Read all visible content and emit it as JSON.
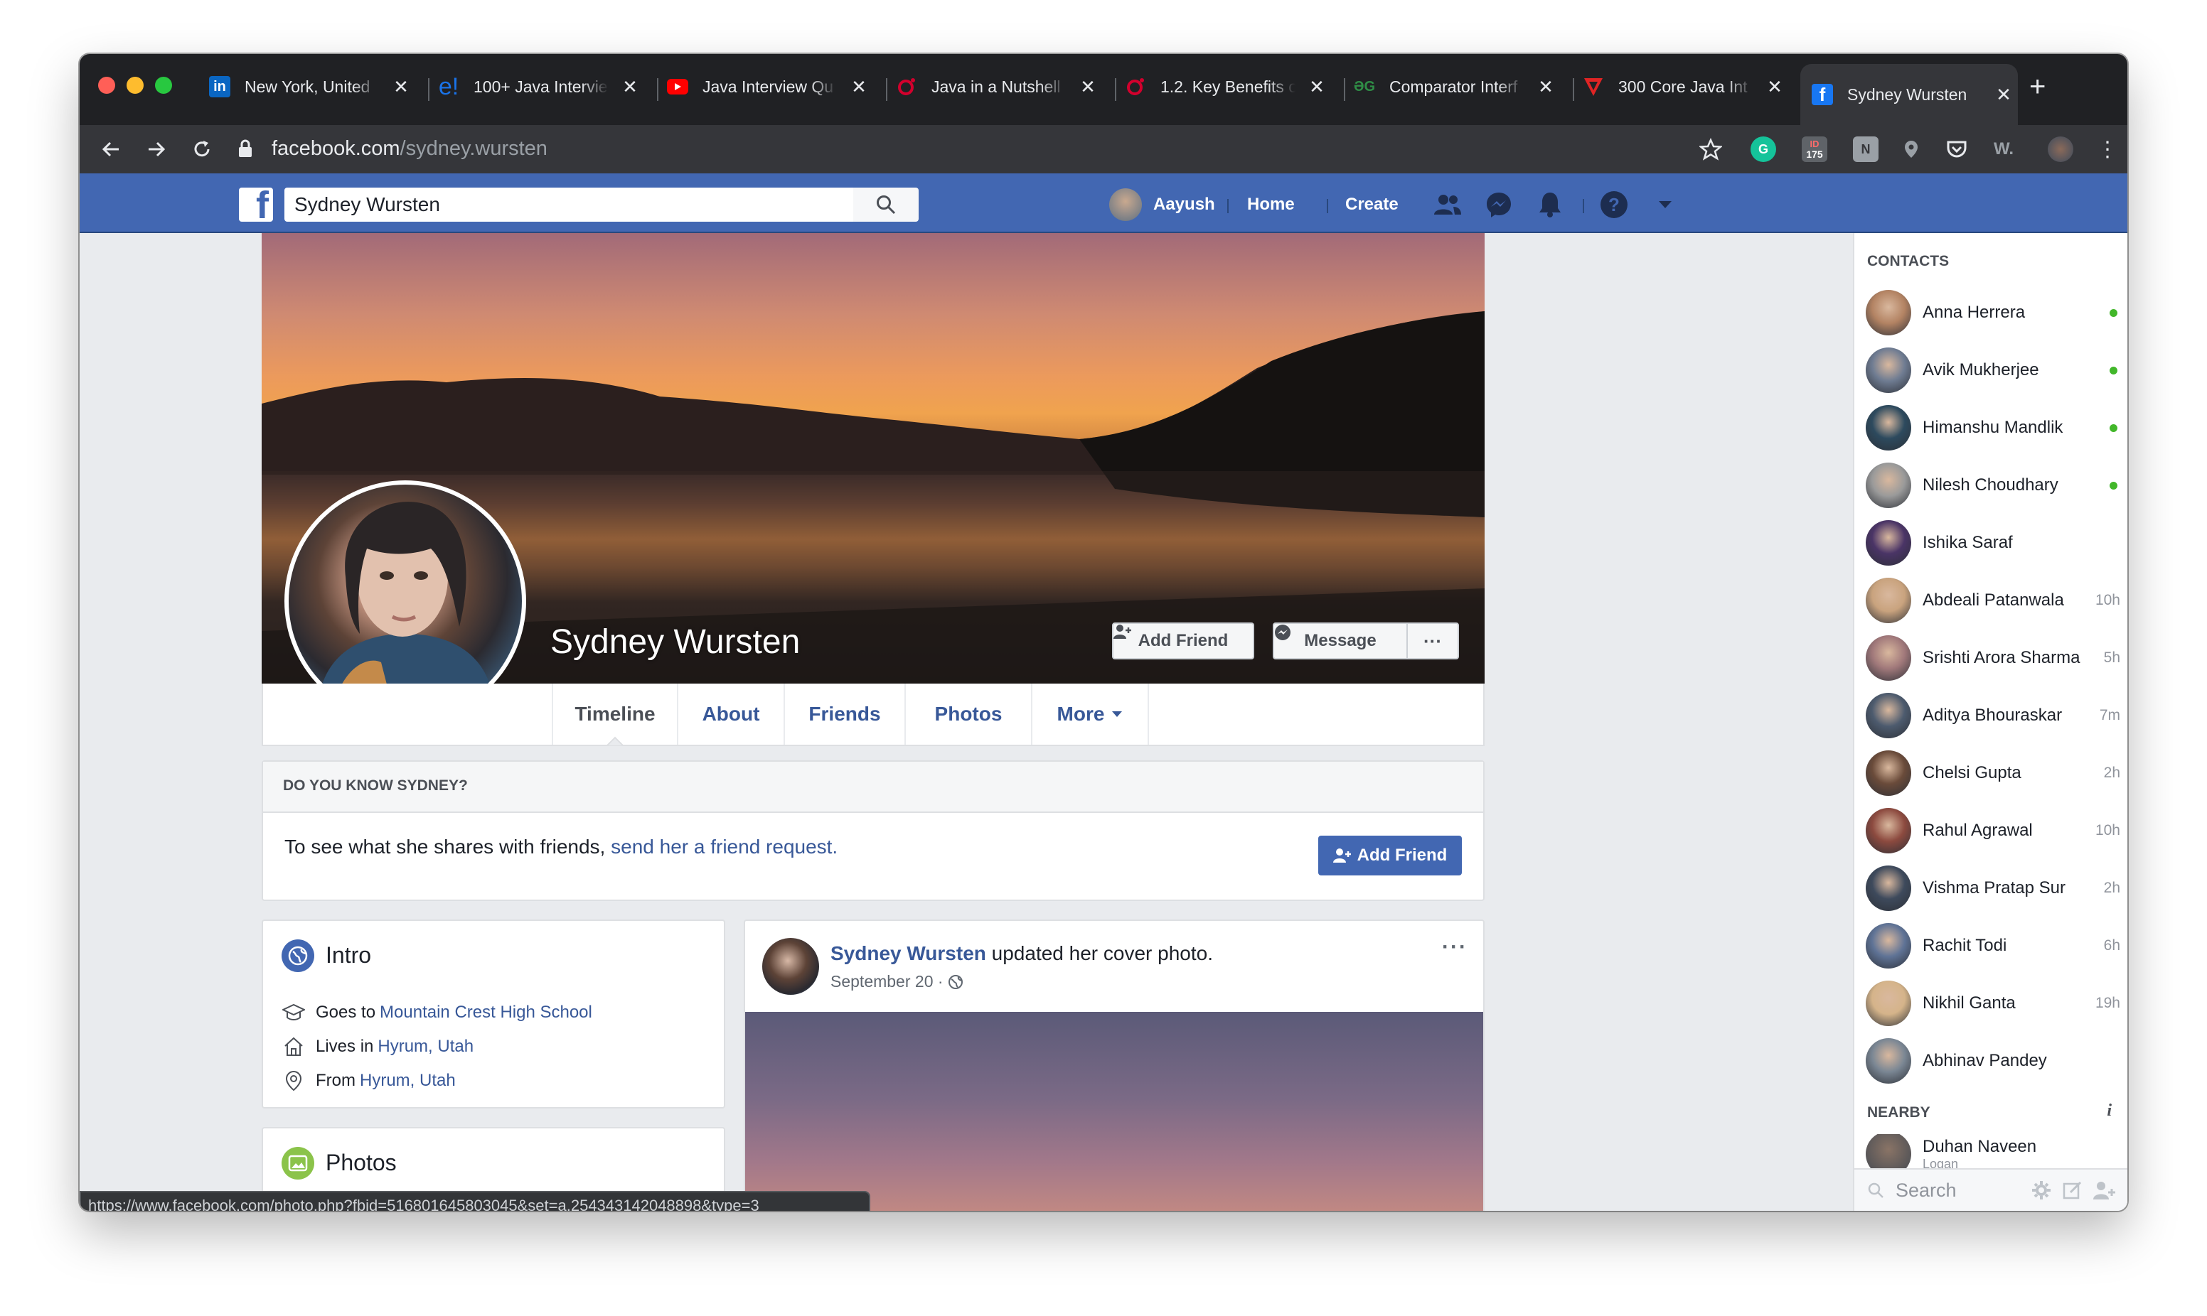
{
  "browser": {
    "tabs": [
      {
        "label": "New York, United",
        "icon": "linkedin-icon",
        "color": "#0a66c2"
      },
      {
        "label": "100+ Java Intervie",
        "icon": "edureka-icon",
        "color": "#1a73e8"
      },
      {
        "label": "Java Interview Qu",
        "icon": "youtube-icon",
        "color": "#ff0000"
      },
      {
        "label": "Java in a Nutshell",
        "icon": "oreilly-icon",
        "color": "#d3002d"
      },
      {
        "label": "1.2. Key Benefits o",
        "icon": "oreilly-icon",
        "color": "#d3002d"
      },
      {
        "label": "Comparator Interf",
        "icon": "geeksforgeeks-icon",
        "color": "#2f8d46"
      },
      {
        "label": "300 Core Java Int",
        "icon": "vskills-icon",
        "color": "#e02424"
      },
      {
        "label": "Sydney Wursten",
        "icon": "facebook-icon",
        "color": "#1877f2",
        "active": true
      }
    ],
    "url_host": "facebook.com",
    "url_path": "/sydney.wursten",
    "ext_badge": "175",
    "status_url": "https://www.facebook.com/photo.php?fbid=516801645803045&set=a.254343142048898&type=3"
  },
  "fb": {
    "search_value": "Sydney Wursten",
    "user_name": "Aayush",
    "nav_home": "Home",
    "nav_create": "Create"
  },
  "profile": {
    "name": "Sydney Wursten",
    "add_friend": "Add Friend",
    "message": "Message",
    "more_dots": "···",
    "tabs": [
      "Timeline",
      "About",
      "Friends",
      "Photos",
      "More"
    ]
  },
  "know": {
    "title": "DO YOU KNOW SYDNEY?",
    "text": "To see what she shares with friends,",
    "link": "send her a friend request.",
    "button": "Add Friend"
  },
  "intro": {
    "title": "Intro",
    "rows": [
      {
        "prefix": "Goes to",
        "link": "Mountain Crest High School"
      },
      {
        "prefix": "Lives in",
        "link": "Hyrum, Utah"
      },
      {
        "prefix": "From",
        "link": "Hyrum, Utah"
      }
    ]
  },
  "photos": {
    "title": "Photos"
  },
  "post": {
    "author": "Sydney Wursten",
    "action": "updated her cover photo.",
    "date": "September 20 ·",
    "more": "···"
  },
  "sidebar": {
    "contacts_title": "CONTACTS",
    "contacts": [
      {
        "name": "Anna Herrera",
        "status": "online",
        "color": "#b38363"
      },
      {
        "name": "Avik Mukherjee",
        "status": "online",
        "color": "#6f7c92"
      },
      {
        "name": "Himanshu Mandlik",
        "status": "online",
        "color": "#2d4a5e"
      },
      {
        "name": "Nilesh Choudhary",
        "status": "online",
        "color": "#9a9a9a"
      },
      {
        "name": "Ishika Saraf",
        "status": "",
        "color": "#4a3466"
      },
      {
        "name": "Abdeali Patanwala",
        "status": "10h",
        "color": "#c9a37e"
      },
      {
        "name": "Srishti Arora Sharma",
        "status": "5h",
        "color": "#a0787a"
      },
      {
        "name": "Aditya Bhouraskar",
        "status": "7m",
        "color": "#4d5b6e"
      },
      {
        "name": "Chelsi Gupta",
        "status": "2h",
        "color": "#6a4b3a"
      },
      {
        "name": "Rahul Agrawal",
        "status": "10h",
        "color": "#8c4a3f"
      },
      {
        "name": "Vishma Pratap Sur",
        "status": "2h",
        "color": "#3e4a5c"
      },
      {
        "name": "Rachit Todi",
        "status": "6h",
        "color": "#5f7396"
      },
      {
        "name": "Nikhil Ganta",
        "status": "19h",
        "color": "#d5b48a"
      },
      {
        "name": "Abhinav Pandey",
        "status": "",
        "color": "#7b8794"
      }
    ],
    "nearby_title": "NEARBY",
    "nearby": [
      {
        "name": "Duhan Naveen",
        "sub": "Logan"
      }
    ],
    "search_placeholder": "Search"
  }
}
